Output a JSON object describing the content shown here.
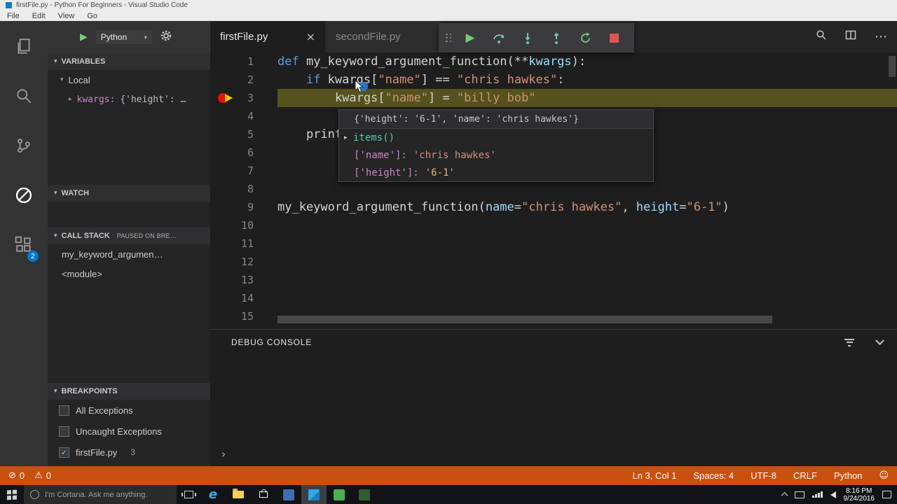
{
  "title_bar": {
    "title": "firstFile.py - Python For Beginners - Visual Studio Code",
    "menus": [
      "File",
      "Edit",
      "View",
      "Go"
    ]
  },
  "activity_bar": {
    "extensions_badge": "2"
  },
  "sidebar": {
    "controls": {
      "config": "Python"
    },
    "variables": {
      "header": "VARIABLES",
      "scope": "Local",
      "var_name": "kwargs:",
      "var_value": "{'height': …"
    },
    "watch": {
      "header": "WATCH"
    },
    "call_stack": {
      "header": "CALL STACK",
      "badge": "PAUSED ON BRE…",
      "frames": [
        "my_keyword_argumen…",
        "<module>"
      ]
    },
    "breakpoints": {
      "header": "BREAKPOINTS",
      "items": [
        {
          "label": "All Exceptions",
          "checked": false
        },
        {
          "label": "Uncaught Exceptions",
          "checked": false
        },
        {
          "label": "firstFile.py",
          "checked": true,
          "badge": "3"
        }
      ]
    }
  },
  "tabs": [
    {
      "label": "firstFile.py",
      "active": true
    },
    {
      "label": "secondFile.py",
      "active": false
    }
  ],
  "editor": {
    "current_line": 3,
    "lines": [
      {
        "num": "1",
        "tokens": [
          [
            "def ",
            "k"
          ],
          [
            "my_keyword_argument_function(**",
            "p"
          ],
          [
            "kwargs",
            "v"
          ],
          [
            "):",
            "p"
          ]
        ]
      },
      {
        "num": "2",
        "tokens": [
          [
            "    ",
            "p"
          ],
          [
            "if ",
            "k"
          ],
          [
            "kwargs[",
            "p"
          ],
          [
            "\"name\"",
            "s"
          ],
          [
            "] == ",
            "p"
          ],
          [
            "\"chris hawkes\"",
            "s"
          ],
          [
            ":",
            "p"
          ]
        ]
      },
      {
        "num": "3",
        "current": true,
        "tokens": [
          [
            "        kwargs[",
            "p"
          ],
          [
            "\"name\"",
            "s"
          ],
          [
            "] = ",
            "p"
          ],
          [
            "\"billy bob\"",
            "s"
          ]
        ]
      },
      {
        "num": "4",
        "tokens": []
      },
      {
        "num": "5",
        "tokens": [
          [
            "    print",
            "p"
          ]
        ]
      },
      {
        "num": "6",
        "tokens": []
      },
      {
        "num": "7",
        "tokens": []
      },
      {
        "num": "8",
        "tokens": []
      },
      {
        "num": "9",
        "tokens": [
          [
            "my_keyword_argument_function(",
            "p"
          ],
          [
            "name",
            "v"
          ],
          [
            "=",
            "p"
          ],
          [
            "\"chris hawkes\"",
            "s"
          ],
          [
            ", ",
            "p"
          ],
          [
            "height",
            "v"
          ],
          [
            "=",
            "p"
          ],
          [
            "\"6-1\"",
            "s"
          ],
          [
            ")",
            "p"
          ]
        ]
      },
      {
        "num": "10",
        "tokens": []
      },
      {
        "num": "11",
        "tokens": []
      },
      {
        "num": "12",
        "tokens": []
      },
      {
        "num": "13",
        "tokens": []
      },
      {
        "num": "14",
        "tokens": []
      },
      {
        "num": "15",
        "tokens": []
      }
    ]
  },
  "hover": {
    "header": "{'height': '6-1', 'name': 'chris hawkes'}",
    "items_label": "items()",
    "rows": [
      {
        "key": "['name']:",
        "value": "'chris hawkes'"
      },
      {
        "key": "['height']:",
        "value": "'6-1'"
      }
    ]
  },
  "panel": {
    "title": "DEBUG CONSOLE",
    "prompt": "›"
  },
  "status_bar": {
    "errors": "0",
    "warnings": "0",
    "ln_col": "Ln 3, Col 1",
    "spaces": "Spaces: 4",
    "encoding": "UTF-8",
    "eol": "CRLF",
    "language": "Python"
  },
  "taskbar": {
    "cortana": "I'm Cortana. Ask me anything.",
    "time": "8:16 PM",
    "date": "9/24/2016"
  },
  "icons": {
    "close": "×",
    "ellipsis": "⋯",
    "dropdown": "▾",
    "section_chevron": "▾",
    "expander": "▸",
    "play": "▶",
    "prompt": "›",
    "error": "⊘",
    "warning": "⚠",
    "smiley": "☺",
    "check": "✓"
  },
  "colors": {
    "accent": "#007ACC",
    "status_bar": "#CA5010",
    "current_line_highlight": "#55521D",
    "breakpoint": "#E51400",
    "current_statement_arrow": "#FFCC00"
  }
}
